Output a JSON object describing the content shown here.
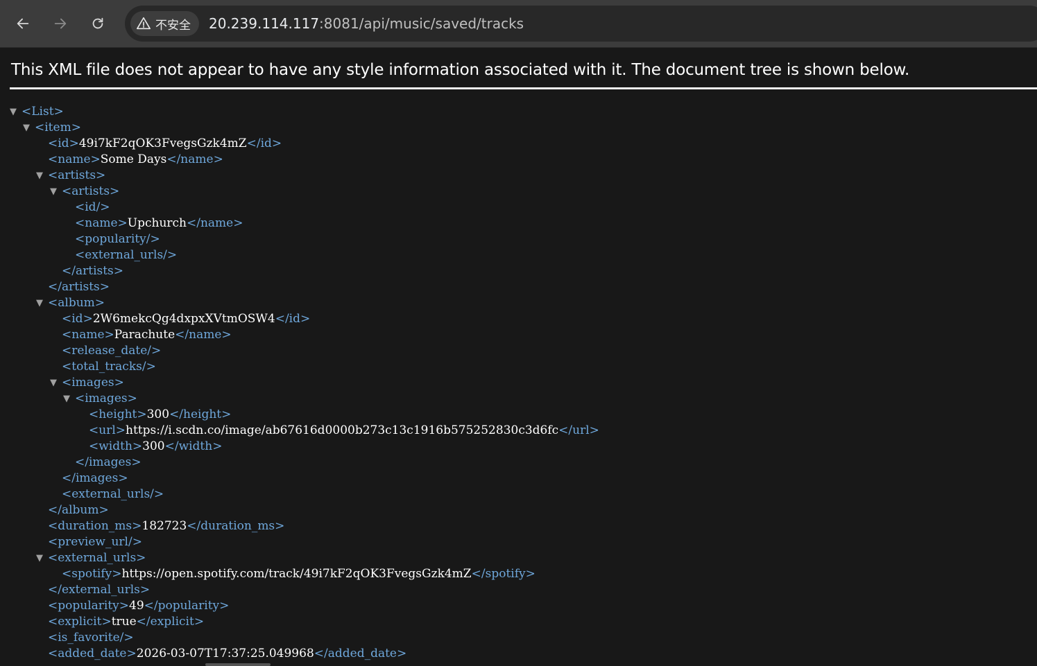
{
  "browser": {
    "security_label": "不安全",
    "url_host": "20.239.114.117",
    "url_path": ":8081/api/music/saved/tracks"
  },
  "page": {
    "xml_info": "This XML file does not appear to have any style information associated with it. The document tree is shown below."
  },
  "xml": {
    "list_open": "<List>",
    "item_open": "<item>",
    "id_open": "<id>",
    "id_value": "49i7kF2qOK3FvegsGzk4mZ",
    "id_close": "</id>",
    "name_open": "<name>",
    "name_value": "Some Days",
    "name_close": "</name>",
    "artists_open": "<artists>",
    "artists_inner_open": "<artists>",
    "artist_id_empty": "<id/>",
    "artist_name_open": "<name>",
    "artist_name_value": "Upchurch",
    "artist_name_close": "</name>",
    "artist_popularity_empty": "<popularity/>",
    "artist_external_urls_empty": "<external_urls/>",
    "artists_inner_close": "</artists>",
    "artists_close": "</artists>",
    "album_open": "<album>",
    "album_id_open": "<id>",
    "album_id_value": "2W6mekcQg4dxpxXVtmOSW4",
    "album_id_close": "</id>",
    "album_name_open": "<name>",
    "album_name_value": "Parachute",
    "album_name_close": "</name>",
    "release_date_empty": "<release_date/>",
    "total_tracks_empty": "<total_tracks/>",
    "images_open": "<images>",
    "images_inner_open": "<images>",
    "height_open": "<height>",
    "height_value": "300",
    "height_close": "</height>",
    "url_open": "<url>",
    "url_value": "https://i.scdn.co/image/ab67616d0000b273c13c1916b575252830c3d6fc",
    "url_close": "</url>",
    "width_open": "<width>",
    "width_value": "300",
    "width_close": "</width>",
    "images_inner_close": "</images>",
    "images_close": "</images>",
    "album_external_urls_empty": "<external_urls/>",
    "album_close": "</album>",
    "duration_open": "<duration_ms>",
    "duration_value": "182723",
    "duration_close": "</duration_ms>",
    "preview_url_empty": "<preview_url/>",
    "external_urls_open": "<external_urls>",
    "spotify_open": "<spotify>",
    "spotify_value": "https://open.spotify.com/track/49i7kF2qOK3FvegsGzk4mZ",
    "spotify_close": "</spotify>",
    "external_urls_close": "</external_urls>",
    "popularity_open": "<popularity>",
    "popularity_value": "49",
    "popularity_close": "</popularity>",
    "explicit_open": "<explicit>",
    "explicit_value": "true",
    "explicit_close": "</explicit>",
    "is_favorite_empty": "<is_favorite/>",
    "added_date_open": "<added_date>",
    "added_date_value": "2026-03-07T17:37:25.049968",
    "added_date_close": "</added_date>",
    "toggle_glyph": "▼"
  }
}
